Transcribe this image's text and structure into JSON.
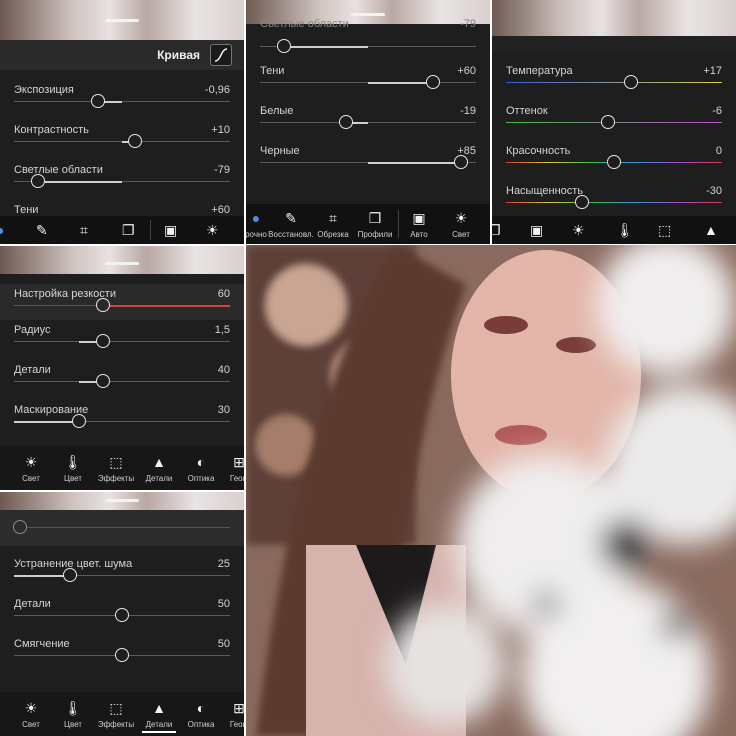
{
  "panel_light_basic": {
    "curve_label": "Кривая",
    "curve_icon": "curve-icon",
    "sliders": [
      {
        "label": "Экспозиция",
        "value": "-0,96",
        "pos": 0.39
      },
      {
        "label": "Контрастность",
        "value": "+10",
        "pos": 0.56
      },
      {
        "label": "Светлые области",
        "value": "-79",
        "pos": 0.11
      },
      {
        "label": "Тени",
        "value": "+60"
      }
    ],
    "toolbar": [
      "bandage-icon",
      "crop-icon",
      "layers-icon",
      "auto-icon",
      "sun-icon"
    ]
  },
  "panel_light_mid": {
    "partial_top": {
      "label": "Светлые области",
      "value": "-79",
      "pos": 0.11
    },
    "sliders": [
      {
        "label": "Тени",
        "value": "+60",
        "pos": 0.8
      },
      {
        "label": "Белые",
        "value": "-19",
        "pos": 0.4
      },
      {
        "label": "Черные",
        "value": "+85",
        "pos": 0.93
      }
    ],
    "toolbar": [
      {
        "icon": "bandage-icon",
        "label": "рочно"
      },
      {
        "icon": "bandage-icon",
        "label": "Восстановл."
      },
      {
        "icon": "crop-icon",
        "label": "Обрезка"
      },
      {
        "icon": "layers-icon",
        "label": "Профили"
      },
      {
        "icon": "auto-icon",
        "label": "Авто"
      },
      {
        "icon": "sun-icon",
        "label": "Свет"
      }
    ]
  },
  "panel_color": {
    "sliders": [
      {
        "label": "Температура",
        "value": "+17",
        "pos": 0.58,
        "gradient": "linear-gradient(90deg,#3a5cd6,#d6d04a)"
      },
      {
        "label": "Оттенок",
        "value": "-6",
        "pos": 0.47,
        "gradient": "linear-gradient(90deg,#3fbf3f,#c04ad0)"
      },
      {
        "label": "Красочность",
        "value": "0",
        "pos": 0.5,
        "gradient": "linear-gradient(90deg,#d43c3c,#d8c93a,#39c04c,#3a8fd6,#a84ad6,#d43c3c)"
      },
      {
        "label": "Насыщенность",
        "value": "-30",
        "pos": 0.35,
        "gradient": "linear-gradient(90deg,#d43c3c,#d8c93a,#39c04c,#3a8fd6,#a84ad6,#d43c3c)"
      }
    ],
    "toolbar": [
      "layers-icon",
      "auto-icon",
      "sun-icon",
      "thermometer-icon",
      "vignette-icon",
      "triangle-icon"
    ]
  },
  "panel_detail": {
    "sliders": [
      {
        "label": "Настройка резкости",
        "value": "60",
        "pos": 0.41,
        "accent": "#d04a3a"
      },
      {
        "label": "Радиус",
        "value": "1,5",
        "pos": 0.41
      },
      {
        "label": "Детали",
        "value": "40",
        "pos": 0.41
      },
      {
        "label": "Маскирование",
        "value": "30",
        "pos": 0.3
      }
    ],
    "toolbar": [
      {
        "icon": "sun-icon",
        "label": "Свет"
      },
      {
        "icon": "thermometer-icon",
        "label": "Цвет"
      },
      {
        "icon": "vignette-icon",
        "label": "Эффекты"
      },
      {
        "icon": "triangle-icon",
        "label": "Детали"
      },
      {
        "icon": "lens-icon",
        "label": "Оптика"
      },
      {
        "icon": "geometry-icon",
        "label": "Геом"
      }
    ]
  },
  "panel_noise": {
    "partial_top_pos": 0.03,
    "sliders": [
      {
        "label": "Устранение цвет. шума",
        "value": "25",
        "pos": 0.26
      },
      {
        "label": "Детали",
        "value": "50",
        "pos": 0.5
      },
      {
        "label": "Смягчение",
        "value": "50",
        "pos": 0.5
      }
    ],
    "toolbar": [
      {
        "icon": "sun-icon",
        "label": "Свет"
      },
      {
        "icon": "thermometer-icon",
        "label": "Цвет"
      },
      {
        "icon": "vignette-icon",
        "label": "Эффекты"
      },
      {
        "icon": "triangle-icon",
        "label": "Детали"
      },
      {
        "icon": "lens-icon",
        "label": "Оптика"
      },
      {
        "icon": "geometry-icon",
        "label": "Геом"
      }
    ]
  },
  "photo": {
    "subject": "portrait-photo"
  }
}
